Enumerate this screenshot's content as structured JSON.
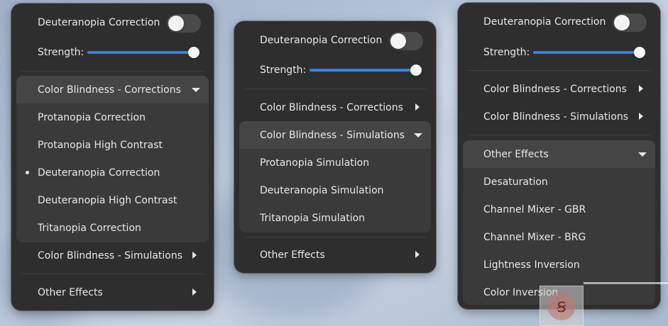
{
  "colors": {
    "accent": "#3584e4",
    "panel": "#2e2e2e",
    "submenu": "#3a3a3a",
    "submenu_header": "#454545",
    "text": "#e8e8e8"
  },
  "panels": [
    {
      "toggle_label": "Deuteranopia Correction",
      "toggle_on": false,
      "strength_label": "Strength:",
      "strength_value": 1.0,
      "corrections_label": "Color Blindness - Corrections",
      "corrections_items": [
        "Protanopia Correction",
        "Protanopia High Contrast",
        "Deuteranopia Correction",
        "Deuteranopia High Contrast",
        "Tritanopia Correction"
      ],
      "selected_item": "Deuteranopia Correction",
      "simulations_label": "Color Blindness - Simulations",
      "other_label": "Other Effects"
    },
    {
      "toggle_label": "Deuteranopia Correction",
      "toggle_on": false,
      "strength_label": "Strength:",
      "strength_value": 1.0,
      "corrections_label": "Color Blindness - Corrections",
      "simulations_label": "Color Blindness - Simulations",
      "simulations_items": [
        "Protanopia Simulation",
        "Deuteranopia Simulation",
        "Tritanopia Simulation"
      ],
      "other_label": "Other Effects"
    },
    {
      "toggle_label": "Deuteranopia Correction",
      "toggle_on": false,
      "strength_label": "Strength:",
      "strength_value": 1.0,
      "corrections_label": "Color Blindness - Corrections",
      "simulations_label": "Color Blindness - Simulations",
      "other_label": "Other Effects",
      "other_items": [
        "Desaturation",
        "Channel Mixer - GBR",
        "Channel Mixer - BRG",
        "Lightness Inversion",
        "Color Inversion"
      ]
    }
  ]
}
